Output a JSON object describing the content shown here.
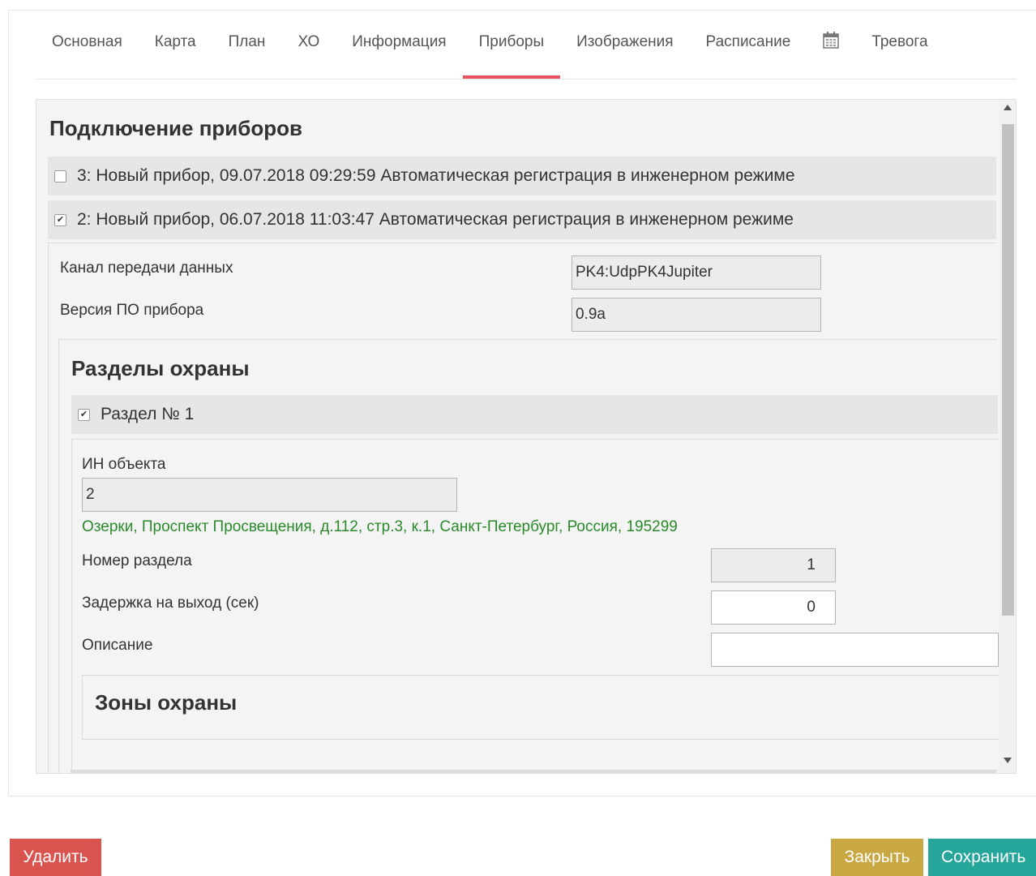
{
  "tabs": [
    {
      "label": "Основная"
    },
    {
      "label": "Карта"
    },
    {
      "label": "План"
    },
    {
      "label": "ХО"
    },
    {
      "label": "Информация"
    },
    {
      "label": "Приборы",
      "active": true
    },
    {
      "label": "Изображения"
    },
    {
      "label": "Расписание"
    },
    {
      "label": "",
      "icon": "calendar-icon"
    },
    {
      "label": "Тревога"
    }
  ],
  "devices": {
    "title": "Подключение приборов",
    "items": [
      {
        "label": "3: Новый прибор, 09.07.2018 09:29:59 Автоматическая регистрация в инженерном режиме",
        "checked": false
      },
      {
        "label": "2: Новый прибор, 06.07.2018 11:03:47 Автоматическая регистрация в инженерном режиме",
        "checked": true
      }
    ],
    "channel_label": "Канал передачи данных",
    "channel_value": "PK4:UdpPK4Jupiter",
    "fw_label": "Версия ПО прибора",
    "fw_value": "0.9a"
  },
  "sections": {
    "title": "Разделы охраны",
    "item_label": "Раздел № 1",
    "item_checked": true,
    "object_id_label": "ИН объекта",
    "object_id_value": "2",
    "address": "Озерки, Проспект Просвещения, д.112, стр.3, к.1, Санкт-Петербург, Россия, 195299",
    "number_label": "Номер раздела",
    "number_value": "1",
    "delay_label": "Задержка на выход (сек)",
    "delay_value": "0",
    "desc_label": "Описание",
    "desc_value": ""
  },
  "zones": {
    "title": "Зоны охраны"
  },
  "buttons": {
    "delete": "Удалить",
    "close": "Закрыть",
    "save": "Сохранить"
  },
  "colors": {
    "active_tab": "#e8545e",
    "delete": "#d9534f",
    "close": "#c9a844",
    "save": "#26a69a",
    "address": "#2a8a2a"
  }
}
